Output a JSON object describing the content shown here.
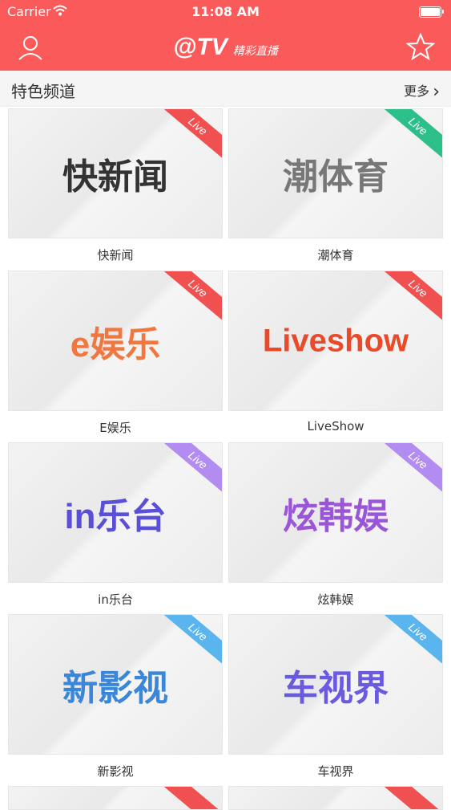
{
  "status": {
    "carrier": "Carrier",
    "time": "11:08 AM"
  },
  "header": {
    "logo_main": "@TV",
    "logo_sub": "精彩直播"
  },
  "section": {
    "title": "特色频道",
    "more": "更多"
  },
  "channels": [
    {
      "name": "快新闻",
      "logo": "快新闻",
      "live": "Live",
      "live_color": "#f05050",
      "logo_color": "#333333"
    },
    {
      "name": "潮体育",
      "logo": "潮体育",
      "live": "Live",
      "live_color": "#2cbf8a",
      "logo_color": "#777777"
    },
    {
      "name": "E娱乐",
      "logo": "e娱乐",
      "live": "Live",
      "live_color": "#f05050",
      "logo_color": "#f07840"
    },
    {
      "name": "LiveShow",
      "logo": "Liveshow",
      "live": "Live",
      "live_color": "#f05050",
      "logo_color": "#e84a2a"
    },
    {
      "name": "in乐台",
      "logo": "in乐台",
      "live": "Live",
      "live_color": "#b28cf0",
      "logo_color": "#5a50d8"
    },
    {
      "name": "炫韩娱",
      "logo": "炫韩娱",
      "live": "Live",
      "live_color": "#b28cf0",
      "logo_color": "#9a55d8"
    },
    {
      "name": "新影视",
      "logo": "新影视",
      "live": "Live",
      "live_color": "#5ab4ee",
      "logo_color": "#3a86d8"
    },
    {
      "name": "车视界",
      "logo": "车视界",
      "live": "Live",
      "live_color": "#5ab4ee",
      "logo_color": "#6a5ae0"
    }
  ]
}
